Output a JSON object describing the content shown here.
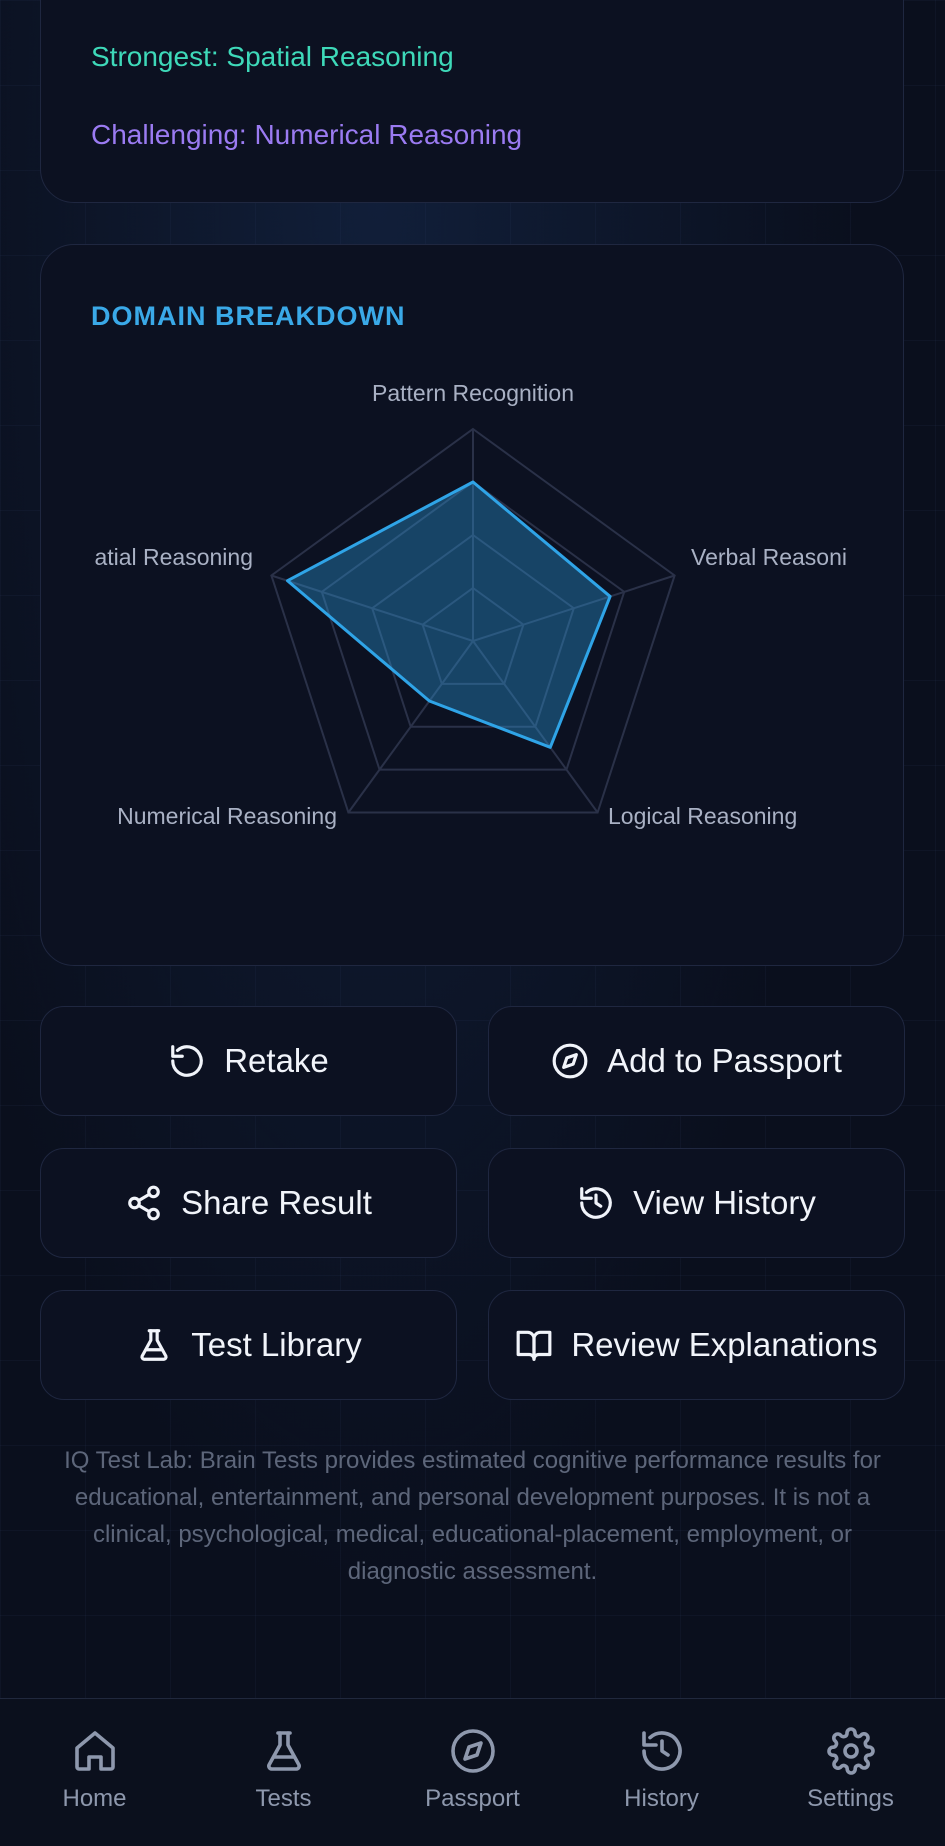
{
  "summary": {
    "strongest": "Strongest: Spatial Reasoning",
    "challenging": "Challenging: Numerical Reasoning"
  },
  "domain_breakdown": {
    "title": "DOMAIN BREAKDOWN",
    "axes": [
      "Pattern Recognition",
      "Verbal Reasoni",
      "Logical Reasoning",
      "Numerical Reasoning",
      "atial Reasoning"
    ],
    "scores": [
      0.75,
      0.68,
      0.62,
      0.35,
      0.92
    ],
    "accent": "#2fa4e7"
  },
  "actions": {
    "retake": "Retake",
    "add_passport": "Add to Passport",
    "share": "Share Result",
    "view_history": "View History",
    "test_library": "Test Library",
    "review": "Review Explanations"
  },
  "disclaimer": "IQ Test Lab: Brain Tests provides estimated cognitive performance results for educational, entertainment, and personal development purposes. It is not a clinical, psychological, medical, educational-placement, employment, or diagnostic assessment.",
  "nav": {
    "home": "Home",
    "tests": "Tests",
    "passport": "Passport",
    "history": "History",
    "settings": "Settings"
  }
}
